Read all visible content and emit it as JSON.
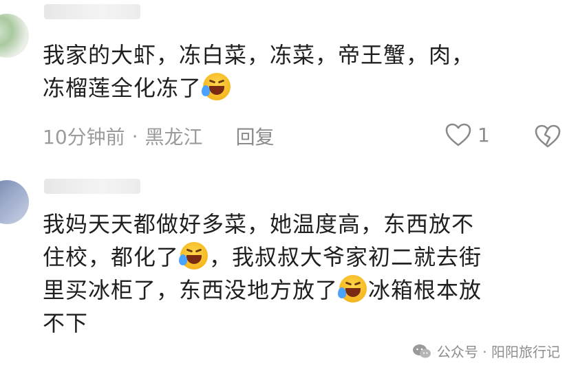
{
  "comments": [
    {
      "text_a": "我家的大虾，冻白菜，冻菜，帝王蟹，肉，\n冻榴莲全化冻了",
      "time": "10分钟前",
      "separator": "·",
      "location": "黑龙江",
      "reply_label": "回复",
      "like_count": "1"
    },
    {
      "text_a": "我妈天天都做好多菜，她温度高，东西放不\n住校，都化了",
      "text_b": "，我叔叔大爷家初二就去街\n里买冰柜了，东西没地方放了",
      "text_c": "冰箱根本放\n不下"
    }
  ],
  "emoji_name": "rolling-on-floor-laughing-crying-emoji",
  "icons": {
    "like": "heart-icon",
    "dislike": "broken-heart-icon",
    "watermark": "wechat-icon"
  },
  "watermark": {
    "text": "公众号 · 阳阳旅行记"
  },
  "colors": {
    "text": "#1f1f1f",
    "meta": "#9b9b9b",
    "emoji": "#f5b820"
  }
}
